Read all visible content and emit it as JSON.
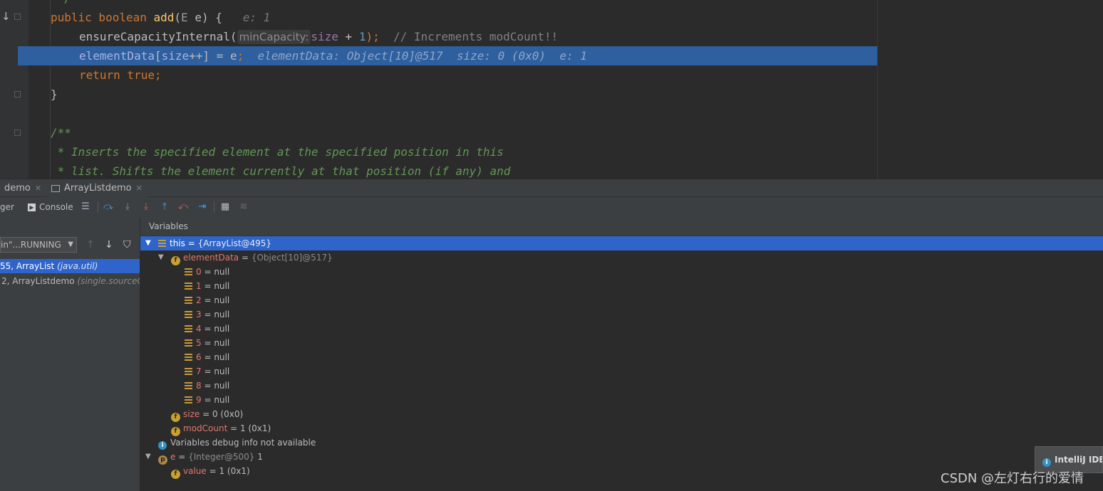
{
  "editor": {
    "lines": [
      {
        "text": "*/"
      },
      {
        "kw1": "public boolean ",
        "fn": "add",
        "open": "(",
        "type": "E",
        "rest": " e) {",
        "hint": "e: 1"
      },
      {
        "call": "ensureCapacityInternal(",
        "param": "minCapacity:",
        "field": "size",
        "plus": " + ",
        "num": "1",
        "close": ");",
        "comment": "// Increments modCount!!"
      },
      {
        "field1": "elementData",
        "br1": "[",
        "field2": "size",
        "inc": "++] = e",
        "semi": ";",
        "hint": "elementData: Object[10]@517  size: 0 (0x0)  e: 1"
      },
      {
        "kw": "return true",
        "semi": ";"
      },
      {
        "text": "}"
      },
      {
        "doc": "/**"
      },
      {
        "doc": " * Inserts the specified element at the specified position in this"
      },
      {
        "doc": " * list. Shifts the element currently at that position (if any) and"
      }
    ]
  },
  "tabs": [
    {
      "label": "demo"
    },
    {
      "label": "ArrayListdemo"
    }
  ],
  "toolbar": {
    "debugger_label": "ger",
    "console_label": "Console"
  },
  "frames": {
    "thread": "in\"...RUNNING",
    "rows": [
      {
        "main": "55, ArrayList ",
        "pkg": "(java.util)"
      },
      {
        "main": "2, ArrayListdemo ",
        "pkg": "(single.sourceC"
      }
    ]
  },
  "variables": {
    "header": "Variables",
    "this": {
      "name": "this",
      "eq": " = ",
      "type": "{ArrayList@495}"
    },
    "elementData": {
      "name": "elementData",
      "eq": " = ",
      "type": "{Object[10]@517}"
    },
    "items": [
      {
        "name": "0",
        "val": " = null"
      },
      {
        "name": "1",
        "val": " = null"
      },
      {
        "name": "2",
        "val": " = null"
      },
      {
        "name": "3",
        "val": " = null"
      },
      {
        "name": "4",
        "val": " = null"
      },
      {
        "name": "5",
        "val": " = null"
      },
      {
        "name": "6",
        "val": " = null"
      },
      {
        "name": "7",
        "val": " = null"
      },
      {
        "name": "8",
        "val": " = null"
      },
      {
        "name": "9",
        "val": " = null"
      }
    ],
    "size": {
      "name": "size",
      "val": " = 0 (0x0)"
    },
    "modCount": {
      "name": "modCount",
      "val": " = 1 (0x1)"
    },
    "info": "Variables debug info not available",
    "e": {
      "name": "e",
      "eq": " = ",
      "type": "{Integer@500}",
      "val": " 1"
    },
    "value": {
      "name": "value",
      "val": " = 1 (0x1)"
    }
  },
  "notification": "IntelliJ IDE",
  "watermark": "CSDN @左灯右行的爱情",
  "colors": {
    "selection": "#2f65ca",
    "execution_line": "#2e5f9e",
    "keyword": "#cc7832",
    "comment_doc": "#629755"
  }
}
